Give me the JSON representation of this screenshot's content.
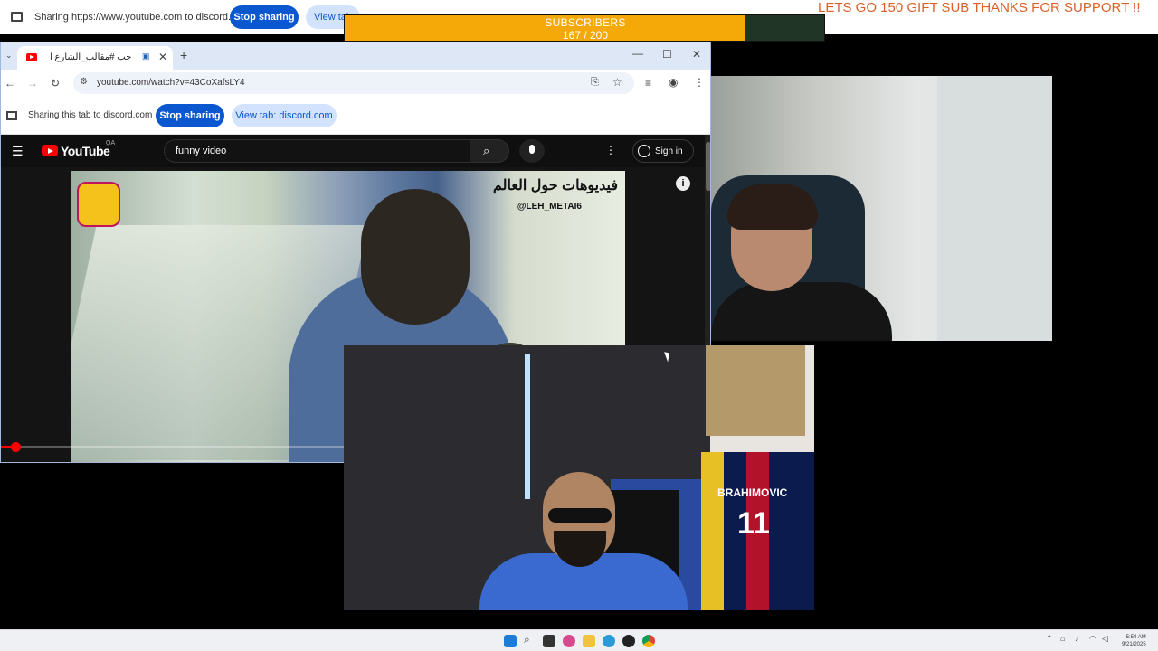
{
  "outer_share": {
    "text": "Sharing https://www.youtube.com to discord.com",
    "stop_label": "Stop sharing",
    "view_label": "View tab"
  },
  "ticker": "LETS GO 150 GIFT SUB THANKS FOR SUPPORT !!",
  "goal": {
    "title": "SUBSCRIBERS",
    "count": "167 / 200",
    "progress": 0.835,
    "colors": {
      "fill": "#f5a908",
      "track": "#203525"
    }
  },
  "browser": {
    "tab_title": "جاسم رجب #مقالب_الشارع ا...",
    "url": "youtube.com/watch?v=43CoXafsLY4",
    "inner_share_text": "Sharing this tab to discord.com",
    "inner_stop_label": "Stop sharing",
    "inner_view_label": "View tab: discord.com"
  },
  "youtube": {
    "logo_text": "YouTube",
    "region": "QA",
    "search_value": "funny video",
    "signin_label": "Sign in",
    "video_caption": "فيديوهات حول العالم",
    "video_handle": "@LEH_METAI6",
    "info_icon": "i",
    "played_fraction": 0.02
  },
  "cam2": {
    "jersey_name": "BRAHIMOVIC",
    "jersey_number": "11"
  },
  "taskbar": {
    "time": "5:54 AM",
    "date": "9/21/2025"
  },
  "colors": {
    "accent": "#0b57d0",
    "youtube_red": "#ff0000",
    "ticker": "#d8622c"
  }
}
